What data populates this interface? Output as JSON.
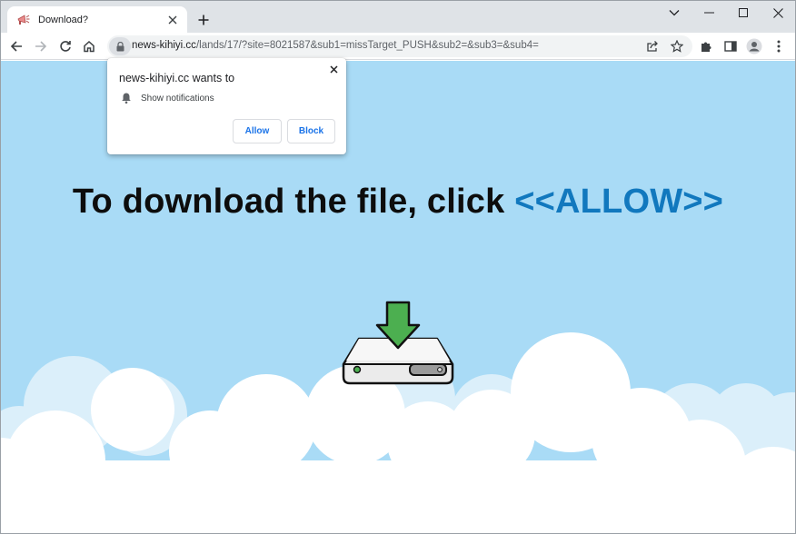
{
  "browser": {
    "tab": {
      "title": "Download?",
      "favicon": "megaphone-favicon-icon"
    },
    "window_controls": [
      "chevron-down-icon",
      "minimize-icon",
      "maximize-icon",
      "close-icon"
    ],
    "toolbar": {
      "nav_icons": [
        "back-icon",
        "forward-icon",
        "reload-icon",
        "home-icon"
      ],
      "url_host": "news-kihiyi.cc",
      "url_path": "/lands/17/?site=8021587&sub1=missTarget_PUSH&sub2=&sub3=&sub4=",
      "right_icons": [
        "share-icon",
        "bookmark-star-icon",
        "extensions-icon",
        "side-panel-icon",
        "profile-icon",
        "more-menu-icon"
      ]
    }
  },
  "popup": {
    "title": "news-kihiyi.cc wants to",
    "permission": "Show notifications",
    "allow_label": "Allow",
    "block_label": "Block"
  },
  "page": {
    "headline_main": "To download the file, click ",
    "headline_accent": "<<ALLOW>>",
    "illustration": "hard-drive-download-icon"
  },
  "colors": {
    "sky": "#a9dbf6",
    "accent": "#1178be",
    "arrow_green": "#4caf50",
    "link_blue": "#1a73e8"
  }
}
